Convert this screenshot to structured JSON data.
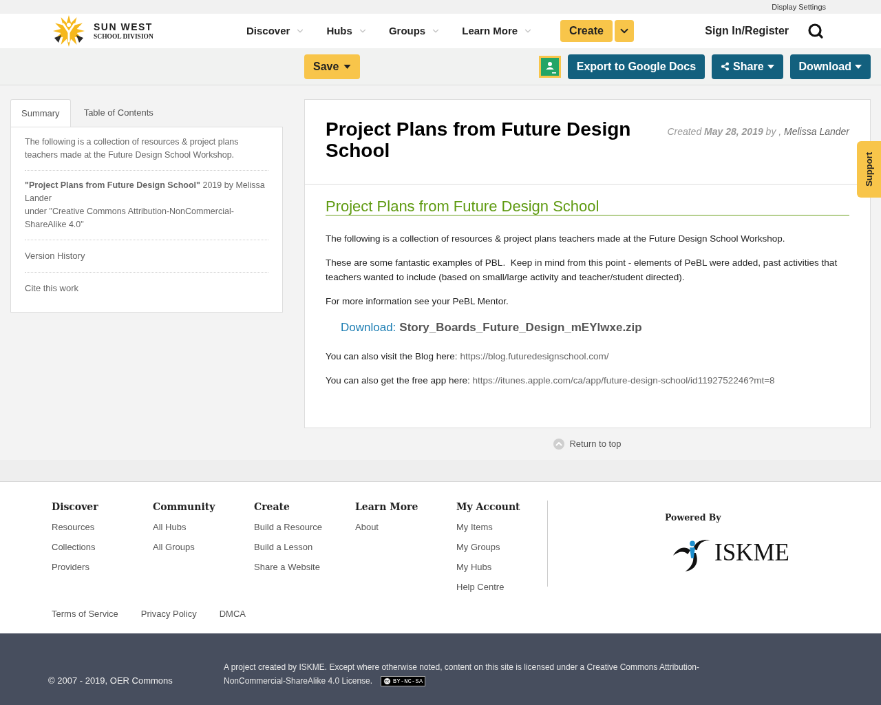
{
  "top_bar": {
    "link": "Display Settings"
  },
  "header": {
    "logo": {
      "title": "SUN WEST",
      "subtitle": "SCHOOL DIVISION"
    },
    "nav": [
      {
        "label": "Discover"
      },
      {
        "label": "Hubs"
      },
      {
        "label": "Groups"
      },
      {
        "label": "Learn More"
      }
    ],
    "create": {
      "label": "Create"
    },
    "sign_in": "Sign In/Register"
  },
  "toolbar": {
    "left": [
      {
        "label": "Save",
        "kind": "dropdown"
      }
    ],
    "right": [
      {
        "label": "Export to Google Docs",
        "kind": "plain"
      },
      {
        "label": "Share",
        "kind": "share"
      },
      {
        "label": "Download",
        "kind": "dropdown"
      }
    ]
  },
  "sidebar": {
    "tabs": [
      {
        "label": "Summary",
        "selected": true
      },
      {
        "label": "Table of Contents",
        "selected": false
      }
    ],
    "summary": "The following is a collection of resources & project plans teachers made at the Future Design School Workshop.",
    "attribution": [
      "**\"Project Plans from Future Design School\"** 2019 by Melissa Lander",
      "under \"Creative Commons Attribution-NonCommercial-ShareAlike 4.0\""
    ],
    "links": [
      "Version History",
      "Cite this work"
    ]
  },
  "resource": {
    "title": "Project Plans from Future Design School",
    "meta": {
      "text": "Created **May 28, 2019** by ,",
      "author": "Melissa Lander"
    },
    "heading": "Project Plans from Future Design School",
    "paragraphs": [
      "The following is a collection of resources & project plans teachers made at the Future Design School Workshop.",
      "These are some fantastic examples of PBL.  Keep in mind from this point - elements of PeBL were added, past activities that teachers wanted to include (based on small/large activity and teacher/student directed).",
      "For more information see your PeBL Mentor."
    ],
    "download": {
      "label": "Download:",
      "file": "Story_Boards_Future_Design_mEYlwxe.zip"
    },
    "link_lines": [
      {
        "text": "You can also visit the Blog here:",
        "url": "https://blog.futuredesignschool.com/"
      },
      {
        "text": "You can also get the free app here:",
        "url": "https://itunes.apple.com/ca/app/future-design-school/id1192752246?mt=8"
      }
    ],
    "return_to_top": "Return to top"
  },
  "support_tab": "Support",
  "footer": {
    "columns": [
      {
        "heading": "Discover",
        "links": [
          "Resources",
          "Collections",
          "Providers"
        ]
      },
      {
        "heading": "Community",
        "links": [
          "All Hubs",
          "All Groups"
        ]
      },
      {
        "heading": "Create",
        "links": [
          "Build a Resource",
          "Build a Lesson",
          "Share a Website"
        ]
      },
      {
        "heading": "Learn More",
        "links": [
          "About"
        ]
      },
      {
        "heading": "My Account",
        "links": [
          "My Items",
          "My Groups",
          "My Hubs",
          "Help Centre"
        ]
      }
    ],
    "legal": [
      "Terms of Service",
      "Privacy Policy",
      "DMCA"
    ],
    "powered_by": "Powered By",
    "partner_logo": "ISKME"
  },
  "bottom_bar": {
    "copyright": "© 2007 - 2019, OER Commons",
    "license": "A project created by ISKME. Except where otherwise noted, content on this site is licensed under a Creative Commons Attribution-NonCommercial-ShareAlike 4.0 License.",
    "badge": "BY-NC-SA"
  }
}
